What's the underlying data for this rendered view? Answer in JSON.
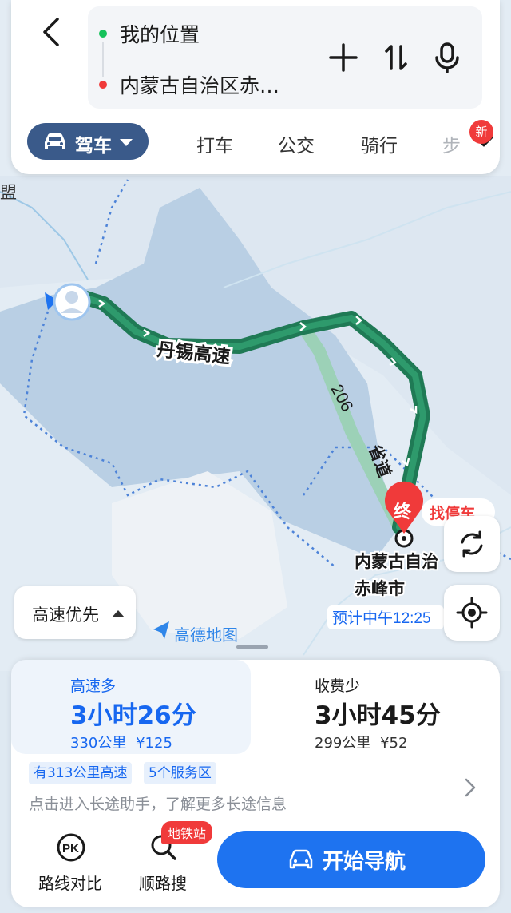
{
  "header": {
    "back_icon": "chevron-left-icon",
    "origin": "我的位置",
    "destination": "内蒙古自治区赤…",
    "actions": [
      "add-icon",
      "swap-icon",
      "mic-icon"
    ]
  },
  "modes": {
    "active": "驾车",
    "items": [
      "打车",
      "公交",
      "骑行",
      "步"
    ],
    "new_badge": "新"
  },
  "map": {
    "labels": {
      "top_left": "盟",
      "highway": "丹锡高速",
      "road_number": "206",
      "road_suffix": "省道",
      "end_marker": "终",
      "parking": "找停车",
      "dest_line1": "内蒙古自治",
      "dest_line2": "赤峰市",
      "eta": "预计中午12:25",
      "brand": "高德地图"
    },
    "colors": {
      "route": "#1f7a55",
      "alt_route": "#9cd1b7",
      "water": "#b9cfe4"
    }
  },
  "controls": {
    "route_pref": "高速优先",
    "refresh_icon": "refresh-icon",
    "locate_icon": "locate-icon"
  },
  "routes": [
    {
      "tag": "高速多",
      "time": "3小时26分",
      "distance": "330公里",
      "cost": "¥125"
    },
    {
      "tag": "收费少",
      "time": "3小时45分",
      "distance": "299公里",
      "cost": "¥52"
    }
  ],
  "chips": [
    "有313公里高速",
    "5个服务区"
  ],
  "hint": "点击进入长途助手，了解更多长途信息",
  "tools": [
    {
      "label": "路线对比",
      "icon": "pk-icon"
    },
    {
      "label": "顺路搜",
      "icon": "search-icon",
      "badge": "地铁站"
    }
  ],
  "start_nav": "开始导航",
  "brand_color": "#1e73f0"
}
